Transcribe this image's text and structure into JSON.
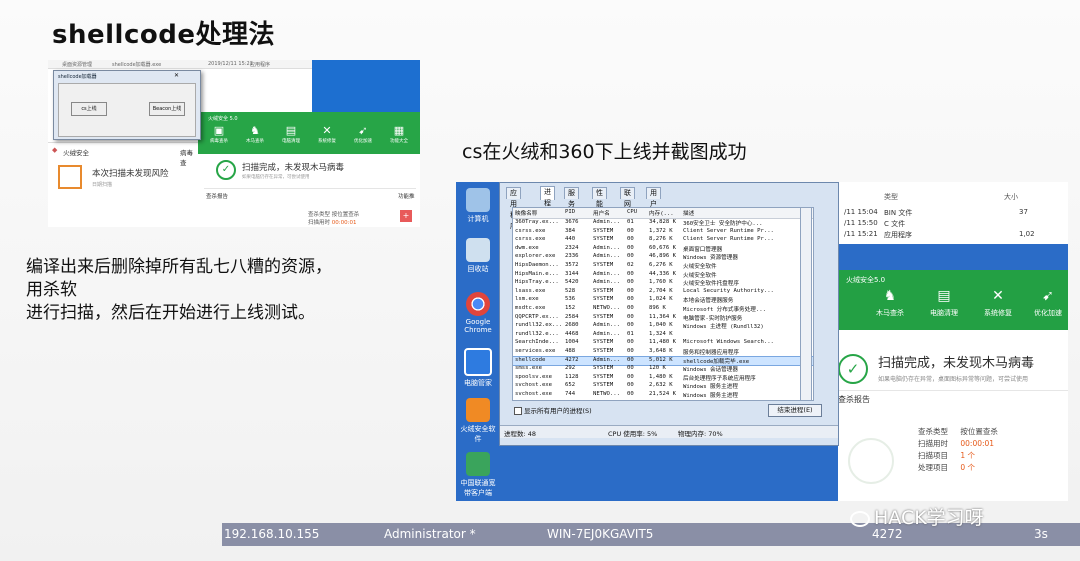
{
  "slide": {
    "title": "shellcode处理法",
    "caption_right": "cs在火绒和360下上线并截图成功",
    "left_text": [
      "编译出来后删除掉所有乱七八糟的资源，",
      "用杀软",
      "进行扫描，然后在开始进行上线测试。"
    ]
  },
  "shot1": {
    "top_items": [
      "桌面资源管理",
      "shellcode加载器.exe",
      "2019/12/11 15:21",
      "应用程序"
    ],
    "dialog_title": "shellcode加载器",
    "button_left": "cs上线",
    "button_right": "Beacon上线",
    "hj_title": "火绒安全 5.0",
    "hj_tools": [
      "病毒查杀",
      "木马查杀",
      "电脑清理",
      "系统修复",
      "优化加速",
      "功能大全"
    ],
    "panel_brand": "火绒安全",
    "panel_right": "病毒查",
    "panel_msg": "本次扫描未发现风险",
    "panel_sub": "日期扫描",
    "scan_result": "扫描完成，未发现木马病毒",
    "scan_sub": "如果电脑仍存在异常，可尝试使用",
    "report": "查杀报告",
    "detail_kind": "查杀类型 按位置查杀",
    "detail_time": "扫描用时",
    "detail_time_val": "00:00:01",
    "more": "功能推"
  },
  "shot2": {
    "desktop_icons": [
      "计算机",
      "回收站",
      "Google Chrome",
      "电脑管家",
      "火绒安全软件",
      "中国联通宽带客户端"
    ],
    "explorer": {
      "header": [
        "类型",
        "大小"
      ],
      "rows": [
        [
          "/11 15:04",
          "BIN 文件",
          "37"
        ],
        [
          "/11 15:50",
          "C 文件",
          ""
        ],
        [
          "/11 15:21",
          "应用程序",
          "1,02"
        ]
      ]
    },
    "hj_title": "火绒安全5.0",
    "hj_tools": [
      "木马查杀",
      "电脑清理",
      "系统修复",
      "优化加速"
    ],
    "scan_result": "扫描完成，未发现木马病毒",
    "scan_sub": "如果电脑仍存在异常，桌面图标异常等问题，可尝试使用",
    "report": "查杀报告",
    "detail": [
      [
        "查杀类型",
        "按位置查杀"
      ],
      [
        "扫描用时",
        "00:00:01"
      ],
      [
        "扫描项目",
        "1 个"
      ],
      [
        "处理项目",
        "0 个"
      ]
    ],
    "task_manager": {
      "tabs": [
        "应用程序",
        "进程",
        "服务",
        "性能",
        "联网",
        "用户"
      ],
      "columns": [
        "映像名称",
        "PID",
        "用户名",
        "CPU",
        "内存(...",
        "描述"
      ],
      "rows": [
        [
          "360Tray.ex...",
          "3676",
          "Admin...",
          "01",
          "34,828 K",
          "360安全卫士 安全防护中心..."
        ],
        [
          "csrss.exe",
          "384",
          "SYSTEM",
          "00",
          "1,372 K",
          "Client Server Runtime Pr..."
        ],
        [
          "csrss.exe",
          "440",
          "SYSTEM",
          "00",
          "8,276 K",
          "Client Server Runtime Pr..."
        ],
        [
          "dwm.exe",
          "2324",
          "Admin...",
          "00",
          "60,676 K",
          "桌面窗口管理器"
        ],
        [
          "explorer.exe",
          "2336",
          "Admin...",
          "00",
          "46,896 K",
          "Windows 资源管理器"
        ],
        [
          "HipsDaemon...",
          "3572",
          "SYSTEM",
          "02",
          "6,276 K",
          "火绒安全软件"
        ],
        [
          "HipsMain.e...",
          "3144",
          "Admin...",
          "00",
          "44,336 K",
          "火绒安全软件"
        ],
        [
          "HipsTray.e...",
          "5420",
          "Admin...",
          "00",
          "1,760 K",
          "火绒安全软件托盘程序"
        ],
        [
          "lsass.exe",
          "528",
          "SYSTEM",
          "00",
          "2,704 K",
          "Local Security Authority..."
        ],
        [
          "lsm.exe",
          "536",
          "SYSTEM",
          "00",
          "1,024 K",
          "本地会话管理器服务"
        ],
        [
          "msdtc.exe",
          "152",
          "NETWO...",
          "00",
          "896 K",
          "Microsoft 分布式事务处理..."
        ],
        [
          "QQPCRTP.ex...",
          "2584",
          "SYSTEM",
          "00",
          "11,364 K",
          "电脑管家-实时防护服务"
        ],
        [
          "rundll32.ex...",
          "2680",
          "Admin...",
          "00",
          "1,040 K",
          "Windows 主进程 (Rundll32)"
        ],
        [
          "rundll32.e...",
          "4468",
          "Admin...",
          "01",
          "1,324 K",
          ""
        ],
        [
          "SearchInde...",
          "1004",
          "SYSTEM",
          "00",
          "11,480 K",
          "Microsoft Windows Search..."
        ],
        [
          "services.exe",
          "488",
          "SYSTEM",
          "00",
          "3,648 K",
          "服务和控制器应用程序"
        ],
        [
          "shellcode",
          "4272",
          "Admin...",
          "00",
          "5,012 K",
          "shellcode加载完毕.exe"
        ],
        [
          "smss.exe",
          "292",
          "SYSTEM",
          "00",
          "120 K",
          "Windows 会话管理器"
        ],
        [
          "spoolsv.exe",
          "1128",
          "SYSTEM",
          "00",
          "1,480 K",
          "后台处理程序子系统应用程序"
        ],
        [
          "svchost.exe",
          "652",
          "SYSTEM",
          "00",
          "2,632 K",
          "Windows 服务主进程"
        ],
        [
          "svchost.exe",
          "744",
          "NETWO...",
          "00",
          "21,524 K",
          "Windows 服务主进程"
        ]
      ],
      "selected_row": 16,
      "show_all": "显示所有用户的进程(S)",
      "end_button": "结束进程(E)",
      "status": [
        "进程数: 48",
        "CPU 使用率: 5%",
        "物理内存: 70%"
      ]
    }
  },
  "bottom_bar": [
    "192.168.10.155",
    "Administrator *",
    "WIN-7EJ0KGAVIT5",
    "4272",
    "3s"
  ],
  "watermark": "HACK学习呀"
}
